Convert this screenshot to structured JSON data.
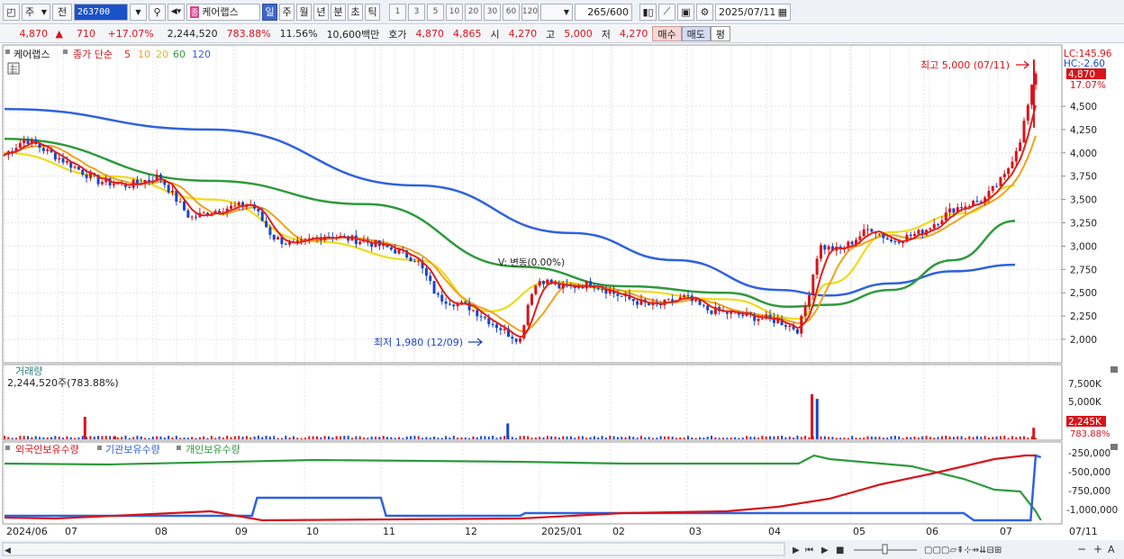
{
  "toolbar": {
    "market_label": "주",
    "prev_label": "전",
    "code": "263700",
    "stock_tag": "종",
    "stock_name": "케어랩스",
    "periods": [
      "일",
      "주",
      "월",
      "년",
      "분",
      "초",
      "틱"
    ],
    "period_active": "일",
    "intervals": [
      "1",
      "3",
      "5",
      "10",
      "20",
      "30",
      "60",
      "120"
    ],
    "count": "265",
    "count_total": "/600",
    "date": "2025/07/11"
  },
  "quote": {
    "price": "4,870",
    "change": "710",
    "change_pct": "+17.07%",
    "volume": "2,244,520",
    "vol_ratio": "783.88%",
    "turnover": "11.56%",
    "amount": "10,600백만",
    "bid_label": "호가",
    "bid1": "4,870",
    "bid2": "4,865",
    "open_label": "시",
    "open": "4,270",
    "high_label": "고",
    "high": "5,000",
    "low_label": "저",
    "low": "4,270",
    "buy_label": "매수",
    "sell_label": "매도",
    "eval_label": "평"
  },
  "legend": {
    "stock": "케어랩스",
    "ma_label": "종가 단순",
    "ma": [
      {
        "period": "5",
        "color": "#e8201c"
      },
      {
        "period": "10",
        "color": "#f0a21b"
      },
      {
        "period": "20",
        "color": "#e6d21b"
      },
      {
        "period": "60",
        "color": "#2e9a3c"
      },
      {
        "period": "120",
        "color": "#2f62e0"
      }
    ]
  },
  "price_panel": {
    "lc": "LC:145.96",
    "hc": "HC:-2.60",
    "last_price": "4,870",
    "last_pct": "17.07%",
    "high_annotation": "최고 5,000 (07/11)",
    "low_annotation": "최저 1,980 (12/09)",
    "vi_annotation": "V: 변동(0.00%)",
    "y_ticks": [
      "4,500",
      "4,250",
      "4,000",
      "3,750",
      "3,500",
      "3,250",
      "3,000",
      "2,750",
      "2,500",
      "2,250",
      "2,000"
    ]
  },
  "volume_panel": {
    "title": "거래량",
    "value": "2,244,520주(783.88%)",
    "y_ticks": [
      "7,500K",
      "5,000K"
    ],
    "last_vol": "2,245K",
    "last_pct": "783.88%"
  },
  "holdings_panel": {
    "legend": [
      {
        "label": "외국인보유수량",
        "color": "#d7141b"
      },
      {
        "label": "기관보유수량",
        "color": "#2f62e0"
      },
      {
        "label": "개인보유수량",
        "color": "#2e9a3c"
      }
    ],
    "y_ticks": [
      "-250,000",
      "-500,000",
      "-750,000",
      "-1,000,000"
    ]
  },
  "x_axis": {
    "labels": [
      "2024/06",
      "07",
      "08",
      "09",
      "10",
      "11",
      "12",
      "2025/01",
      "02",
      "03",
      "04",
      "05",
      "06",
      "07"
    ],
    "right_label": "07/11"
  },
  "chart_data": {
    "type": "candlestick",
    "x_range": [
      "2024/06",
      "2025/07/11"
    ],
    "ylim": [
      1900,
      5050
    ],
    "moving_averages": {
      "ma120": {
        "x": [
          0,
          0.2,
          0.4,
          0.55,
          0.65,
          0.75,
          0.8,
          0.86,
          0.92,
          0.98
        ],
        "y": [
          4470,
          4250,
          3650,
          3140,
          2850,
          2530,
          2470,
          2600,
          2730,
          2800
        ]
      },
      "ma60": {
        "x": [
          0,
          0.2,
          0.35,
          0.5,
          0.6,
          0.7,
          0.76,
          0.8,
          0.86,
          0.92,
          0.98
        ],
        "y": [
          4150,
          3700,
          3450,
          2780,
          2570,
          2500,
          2350,
          2370,
          2530,
          2850,
          3270
        ]
      },
      "ma20": {
        "x": [
          0,
          0.1,
          0.2,
          0.3,
          0.4,
          0.47,
          0.53,
          0.6,
          0.7,
          0.77,
          0.8,
          0.86,
          0.93,
          0.98
        ],
        "y": [
          4000,
          3750,
          3500,
          3050,
          2850,
          2300,
          2620,
          2520,
          2430,
          2220,
          2600,
          3150,
          3350,
          3650
        ]
      }
    },
    "annotations": {
      "high": 5000,
      "low": 1980,
      "last": 4870
    },
    "volume_spikes_k": [
      4400,
      600,
      3100,
      8800,
      7900,
      2245
    ]
  }
}
